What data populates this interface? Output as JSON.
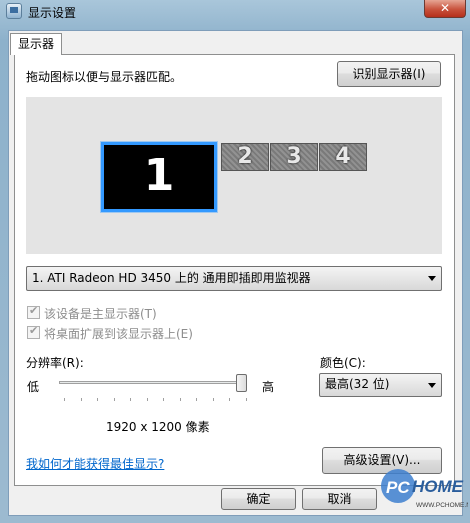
{
  "window": {
    "title": "显示设置",
    "close_glyph": "✕"
  },
  "tabs": [
    {
      "label": "显示器"
    }
  ],
  "instruction": "拖动图标以便与显示器匹配。",
  "identify_button": "识别显示器(I)",
  "monitors": [
    {
      "number": "1",
      "selected": true
    },
    {
      "number": "2"
    },
    {
      "number": "3"
    },
    {
      "number": "4"
    }
  ],
  "display_select": {
    "value": "1. ATI Radeon HD 3450 上的 通用即插即用监视器"
  },
  "checkboxes": [
    {
      "label": "该设备是主显示器(T)",
      "checked": true,
      "enabled": false
    },
    {
      "label": "将桌面扩展到该显示器上(E)",
      "checked": true,
      "enabled": false
    }
  ],
  "resolution": {
    "label": "分辨率(R):",
    "low": "低",
    "high": "高",
    "value_text": "1920 x 1200 像素",
    "slider_level": 1.0
  },
  "color": {
    "label": "颜色(C):",
    "value": "最高(32 位)"
  },
  "help_link": "我如何才能获得最佳显示?",
  "advanced_button": "高级设置(V)...",
  "ok_button": "确定",
  "cancel_button": "取消",
  "watermark": {
    "brand": "PCHOME",
    "url": "WWW.PCHOME.NET"
  },
  "colors": {
    "accent": "#3399ff",
    "link": "#0066cc",
    "close": "#c8523c"
  }
}
